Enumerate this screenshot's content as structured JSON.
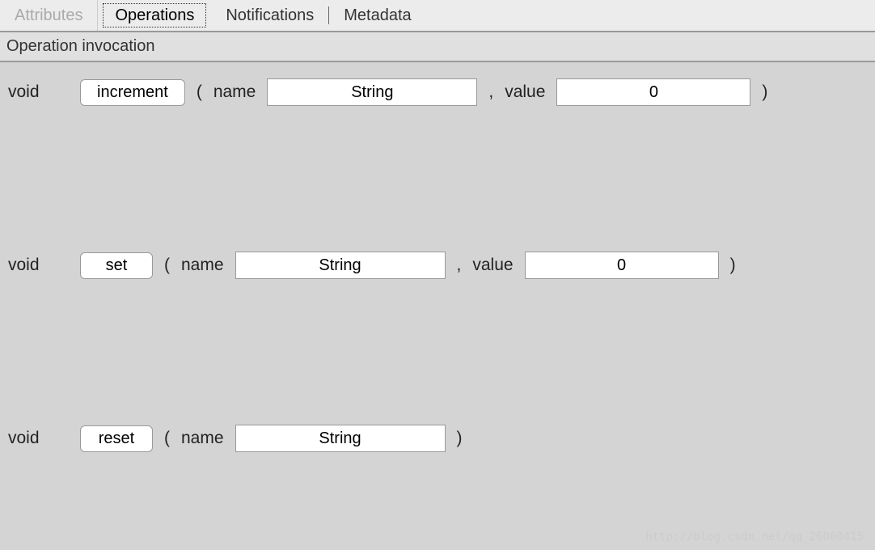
{
  "tabs": {
    "attributes": "Attributes",
    "operations": "Operations",
    "notifications": "Notifications",
    "metadata": "Metadata"
  },
  "panel_title": "Operation invocation",
  "ops": {
    "increment": {
      "return": "void",
      "button": "increment",
      "p1_label": "name",
      "p1_value": "String",
      "p2_label": "value",
      "p2_value": "0"
    },
    "set": {
      "return": "void",
      "button": "set",
      "p1_label": "name",
      "p1_value": "String",
      "p2_label": "value",
      "p2_value": "0"
    },
    "reset": {
      "return": "void",
      "button": "reset",
      "p1_label": "name",
      "p1_value": "String"
    }
  },
  "symbols": {
    "open": "(",
    "close": ")",
    "comma": ","
  },
  "watermark": "http://blog.csdn.net/qq_26000415"
}
